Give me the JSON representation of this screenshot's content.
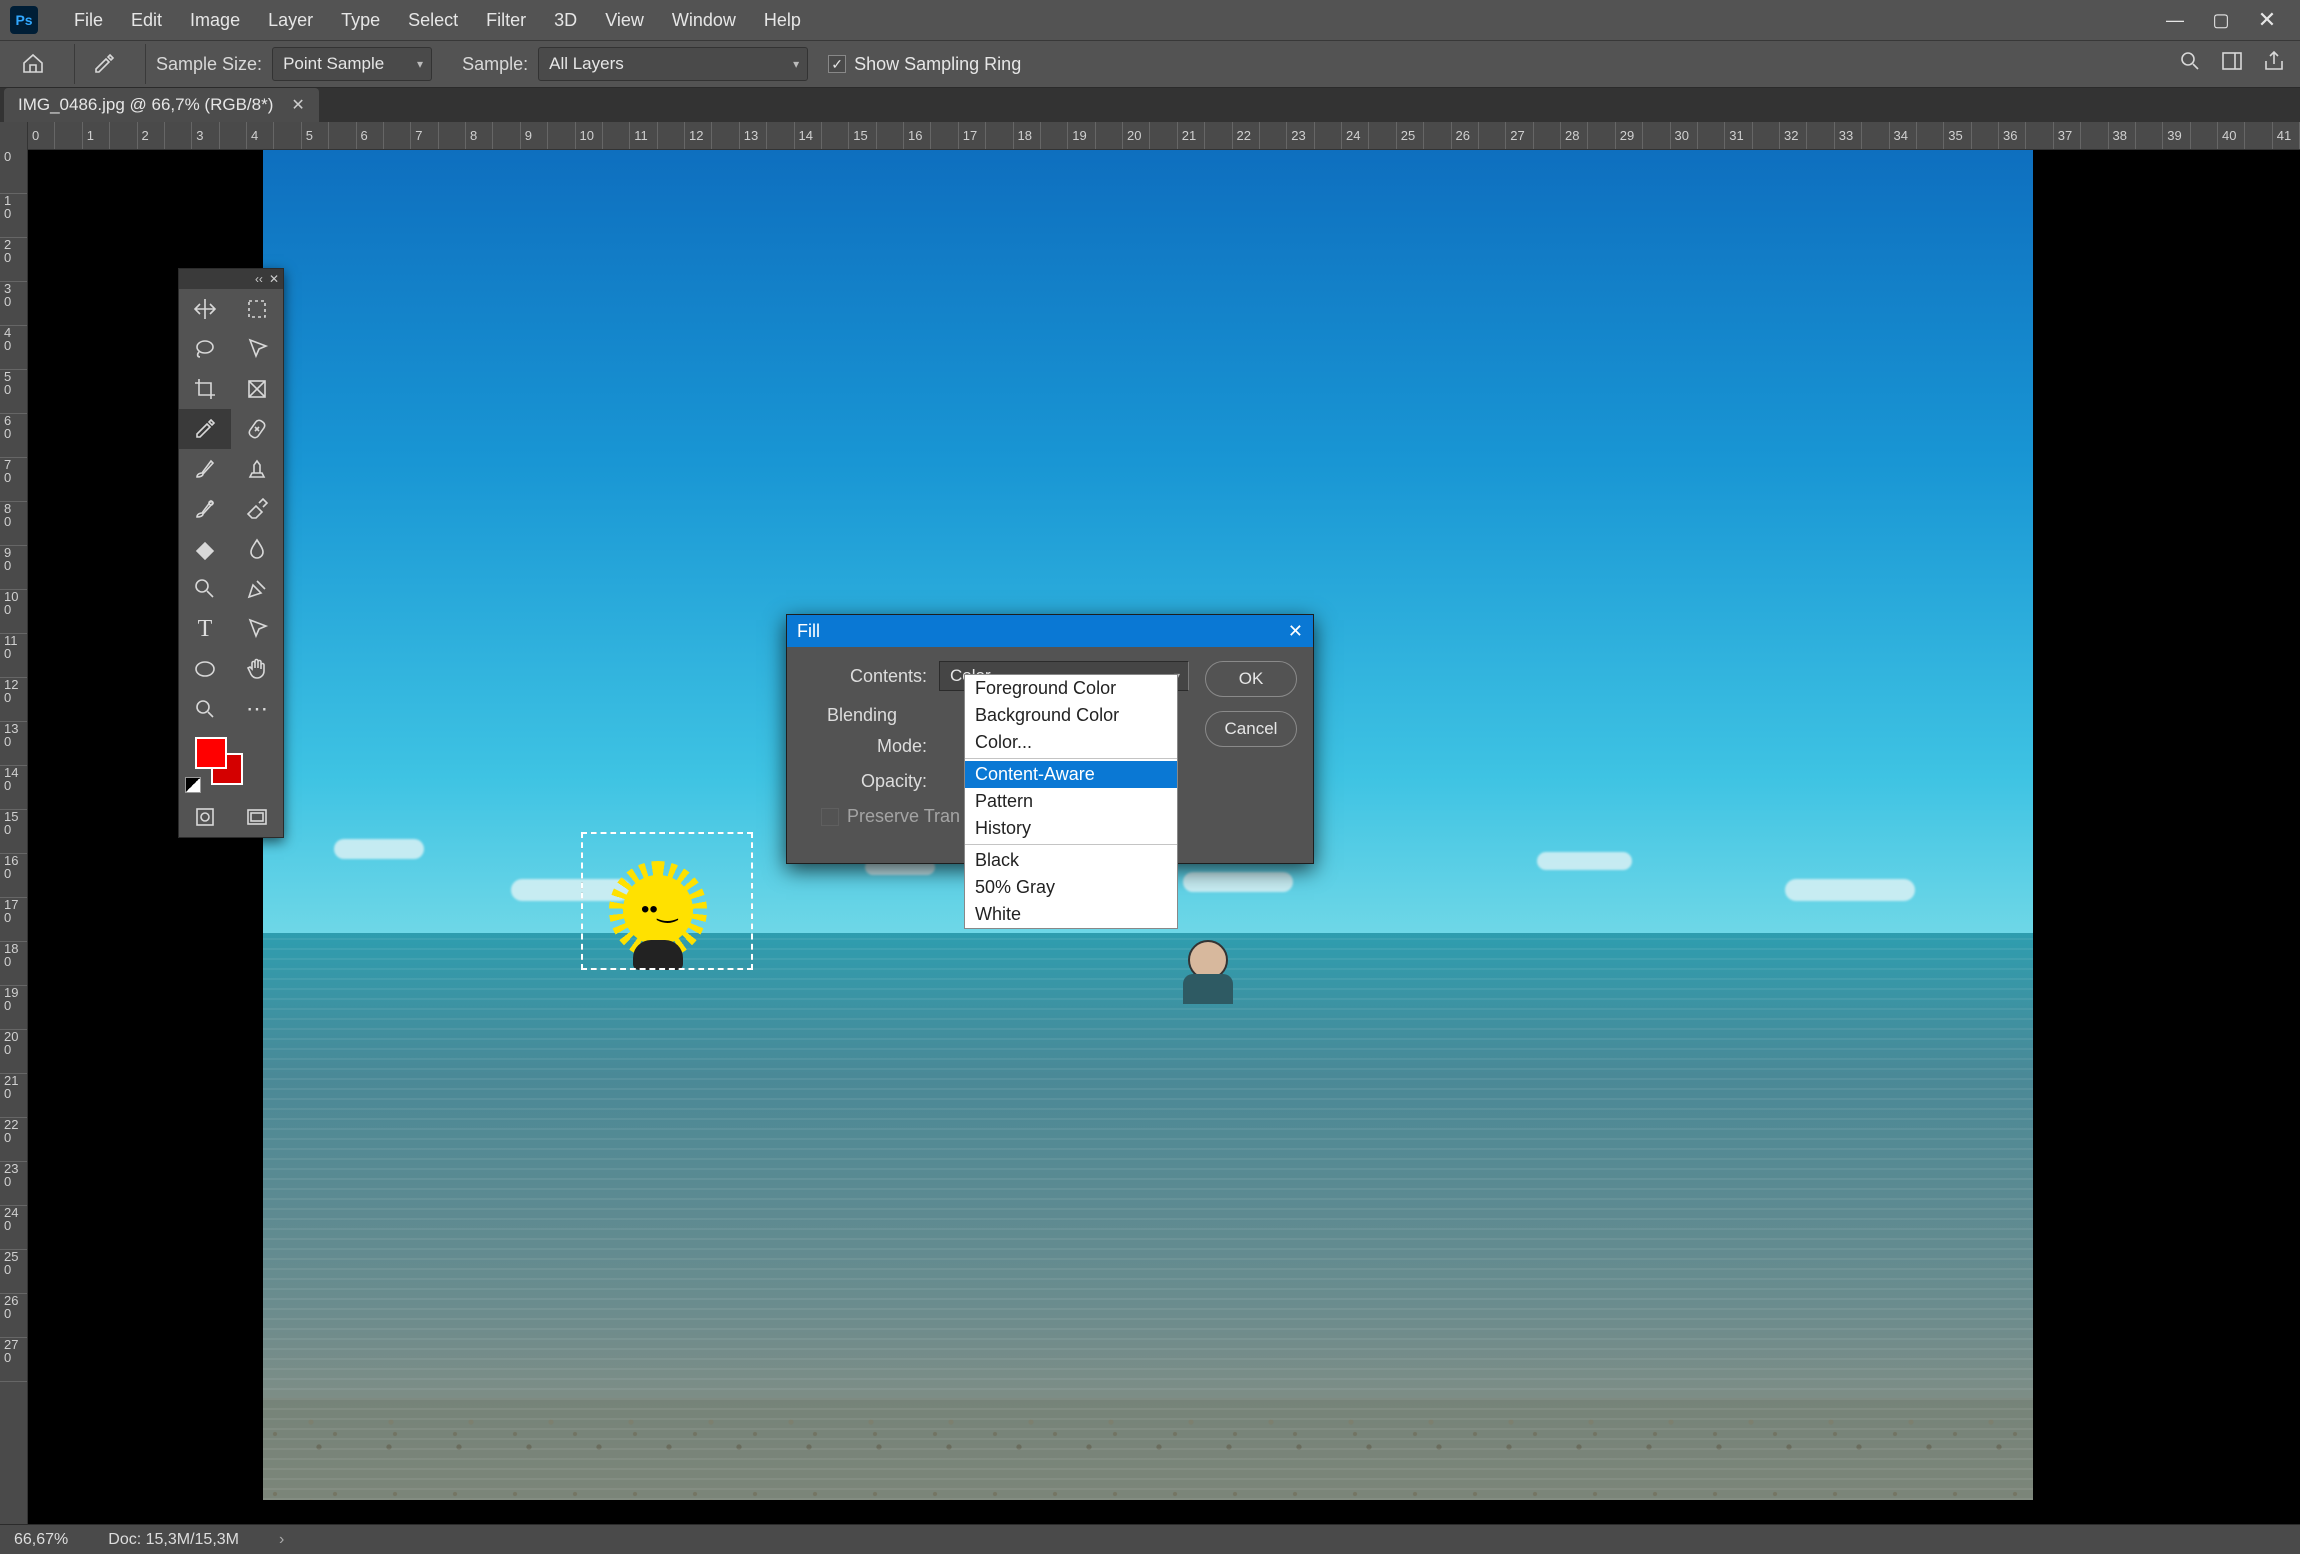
{
  "menubar": {
    "logo": "Ps",
    "items": [
      "File",
      "Edit",
      "Image",
      "Layer",
      "Type",
      "Select",
      "Filter",
      "3D",
      "View",
      "Window",
      "Help"
    ]
  },
  "optionsbar": {
    "sample_size_label": "Sample Size:",
    "sample_size_value": "Point Sample",
    "sample_label": "Sample:",
    "sample_value": "All Layers",
    "show_sampling_ring_label": "Show Sampling Ring"
  },
  "tab": {
    "title": "IMG_0486.jpg @ 66,7% (RGB/8*)"
  },
  "ruler_h": [
    "0",
    "",
    "1",
    "",
    "2",
    "",
    "3",
    "",
    "4",
    "",
    "5",
    "",
    "6",
    "",
    "7",
    "",
    "8",
    "",
    "9",
    "",
    "10",
    "",
    "11",
    "",
    "12",
    "",
    "13",
    "",
    "14",
    "",
    "15",
    "",
    "16",
    "",
    "17",
    "",
    "18",
    "",
    "19",
    "",
    "20",
    "",
    "21",
    "",
    "22",
    "",
    "23",
    "",
    "24",
    "",
    "25",
    "",
    "26",
    "",
    "27",
    "",
    "28",
    "",
    "29",
    "",
    "30",
    "",
    "31",
    "",
    "32",
    "",
    "33",
    "",
    "34",
    "",
    "35",
    "",
    "36",
    "",
    "37",
    "",
    "38",
    "",
    "39",
    "",
    "40",
    "",
    "41"
  ],
  "ruler_v": [
    "0",
    "1",
    "2",
    "3",
    "4",
    "5",
    "6",
    "7",
    "8",
    "9",
    "10",
    "11",
    "12",
    "13",
    "14",
    "15",
    "16",
    "17",
    "18",
    "19",
    "20",
    "21",
    "22",
    "23",
    "24",
    "25",
    "26",
    "27"
  ],
  "ruler_v_sub": [
    "",
    "0",
    "0",
    "0",
    "0",
    "0",
    "0",
    "0",
    "0",
    "0",
    "0",
    "0",
    "0",
    "0",
    "0",
    "0",
    "0",
    "0",
    "0",
    "0",
    "0",
    "0",
    "0",
    "0",
    "0",
    "0",
    "0",
    "0"
  ],
  "dialog": {
    "title": "Fill",
    "contents_label": "Contents:",
    "contents_value": "Color...",
    "blending_label": "Blending",
    "mode_label": "Mode:",
    "opacity_label": "Opacity:",
    "preserve_label": "Preserve Tran",
    "ok": "OK",
    "cancel": "Cancel",
    "options": {
      "g1": [
        "Foreground Color",
        "Background Color",
        "Color..."
      ],
      "g2": [
        "Content-Aware",
        "Pattern",
        "History"
      ],
      "g3": [
        "Black",
        "50% Gray",
        "White"
      ],
      "highlighted": "Content-Aware"
    }
  },
  "statusbar": {
    "zoom": "66,67%",
    "doc": "Doc: 15,3M/15,3M"
  },
  "tool_icons": [
    "✥",
    "⬚",
    "◯",
    "✎",
    "✂",
    "▣",
    "⎋",
    "◧",
    "✏",
    "⎌",
    "✐",
    "◨",
    "◆",
    "💧",
    "🔍",
    "✦",
    "T",
    "↖",
    "◯",
    "✋",
    "⊕",
    "⋯"
  ],
  "color_swatches": {
    "fg": "#ff0000",
    "bg": "#d40000"
  }
}
